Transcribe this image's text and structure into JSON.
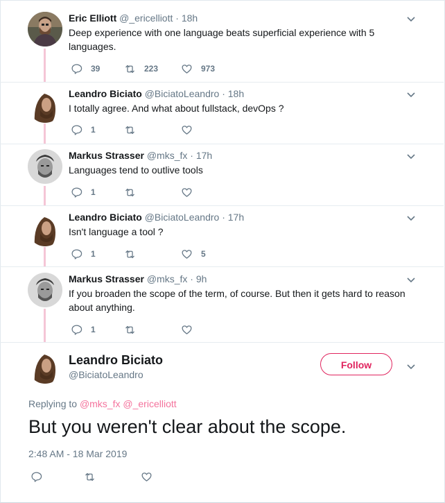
{
  "colors": {
    "accent": "#e0245e",
    "mention": "#f4729c",
    "muted": "#657786",
    "thread": "#f5c6d6"
  },
  "tweets": [
    {
      "name": "Eric Elliott",
      "handle": "@_ericelliott",
      "dot": "·",
      "time": "18h",
      "text": "Deep experience with one language beats superficial experience with 5 languages.",
      "reply_count": "39",
      "retweet_count": "223",
      "like_count": "973",
      "avatar_icon": "avatar-photo"
    },
    {
      "name": "Leandro Biciato",
      "handle": "@BiciatoLeandro",
      "dot": "·",
      "time": "18h",
      "text": "I totally agree. And what about fullstack, devOps ?",
      "reply_count": "1",
      "retweet_count": "",
      "like_count": "",
      "avatar_icon": "avatar-photo"
    },
    {
      "name": "Markus Strasser",
      "handle": "@mks_fx",
      "dot": "·",
      "time": "17h",
      "text": "Languages tend to outlive tools",
      "reply_count": "1",
      "retweet_count": "",
      "like_count": "",
      "avatar_icon": "avatar-photo"
    },
    {
      "name": "Leandro Biciato",
      "handle": "@BiciatoLeandro",
      "dot": "·",
      "time": "17h",
      "text": "Isn't language a tool ?",
      "reply_count": "1",
      "retweet_count": "",
      "like_count": "5",
      "avatar_icon": "avatar-photo"
    },
    {
      "name": "Markus Strasser",
      "handle": "@mks_fx",
      "dot": "·",
      "time": "9h",
      "text": "If you broaden the scope of the term, of course. But then it gets hard to reason about anything.",
      "reply_count": "1",
      "retweet_count": "",
      "like_count": "",
      "avatar_icon": "avatar-photo"
    }
  ],
  "main": {
    "name": "Leandro Biciato",
    "handle": "@BiciatoLeandro",
    "follow_label": "Follow",
    "replying_prefix": "Replying to",
    "mention_1": "@mks_fx",
    "mention_2": "@_ericelliott",
    "text": "But you weren't clear about the scope.",
    "timestamp": "2:48 AM - 18 Mar 2019"
  }
}
